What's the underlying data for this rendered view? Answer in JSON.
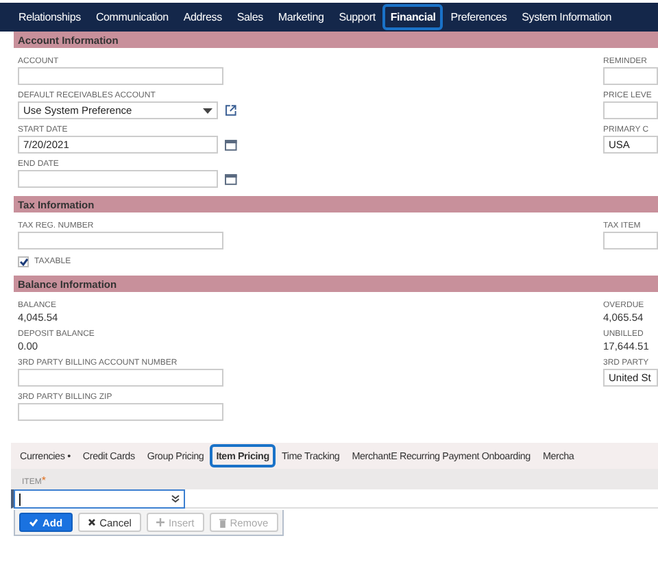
{
  "nav_tabs": [
    {
      "label": "Relationships",
      "selected": false
    },
    {
      "label": "Communication",
      "selected": false
    },
    {
      "label": "Address",
      "selected": false
    },
    {
      "label": "Sales",
      "selected": false
    },
    {
      "label": "Marketing",
      "selected": false
    },
    {
      "label": "Support",
      "selected": false
    },
    {
      "label": "Financial",
      "selected": true
    },
    {
      "label": "Preferences",
      "selected": false
    },
    {
      "label": "System Information",
      "selected": false
    }
  ],
  "sections": [
    {
      "title": "Account Information",
      "left": [
        {
          "kind": "input",
          "label": "ACCOUNT"
        },
        {
          "kind": "select",
          "label": "DEFAULT RECEIVABLES ACCOUNT",
          "value": "Use System Preference"
        },
        {
          "kind": "date",
          "label": "START DATE",
          "value": "7/20/2021"
        },
        {
          "kind": "date",
          "label": "END DATE"
        }
      ],
      "right": [
        {
          "kind": "input",
          "label": "REMINDER"
        },
        {
          "kind": "input",
          "label": "PRICE LEVE"
        },
        {
          "kind": "input",
          "label": "PRIMARY C",
          "value": "USA"
        }
      ]
    },
    {
      "title": "Tax Information",
      "left": [
        {
          "kind": "input",
          "label": "TAX REG. NUMBER"
        },
        {
          "kind": "checkbox",
          "label": "TAXABLE",
          "checked": true
        }
      ],
      "right": [
        {
          "kind": "input",
          "label": "TAX ITEM"
        }
      ]
    },
    {
      "title": "Balance Information",
      "left": [
        {
          "kind": "text",
          "label": "BALANCE",
          "value": "4,045.54"
        },
        {
          "kind": "text",
          "label": "DEPOSIT BALANCE",
          "value": "0.00"
        },
        {
          "kind": "input",
          "label": "3RD PARTY BILLING ACCOUNT NUMBER"
        },
        {
          "kind": "input",
          "label": "3RD PARTY BILLING ZIP"
        }
      ],
      "right": [
        {
          "kind": "text",
          "label": "OVERDUE",
          "value": "4,065.54"
        },
        {
          "kind": "text",
          "label": "UNBILLED",
          "value": "17,644.51"
        },
        {
          "kind": "input",
          "label": "3RD PARTY",
          "value": "United St"
        }
      ]
    }
  ],
  "sub_tabs": [
    {
      "label": "Currencies",
      "dot": "•",
      "selected": false
    },
    {
      "label": "Credit Cards",
      "selected": false
    },
    {
      "label": "Group Pricing",
      "selected": false
    },
    {
      "label": "Item Pricing",
      "selected": true
    },
    {
      "label": "Time Tracking",
      "selected": false
    },
    {
      "label": "MerchantE Recurring Payment Onboarding",
      "selected": false
    },
    {
      "label": "Mercha",
      "selected": false
    }
  ],
  "item_table": {
    "column": "ITEM",
    "required_mark": "*",
    "focused": true
  },
  "buttons": [
    {
      "kind": "add",
      "label": "Add",
      "disabled": false
    },
    {
      "kind": "cancel",
      "label": "Cancel",
      "disabled": false
    },
    {
      "kind": "insert",
      "label": "Insert",
      "disabled": true
    },
    {
      "kind": "remove",
      "label": "Remove",
      "disabled": true
    }
  ]
}
